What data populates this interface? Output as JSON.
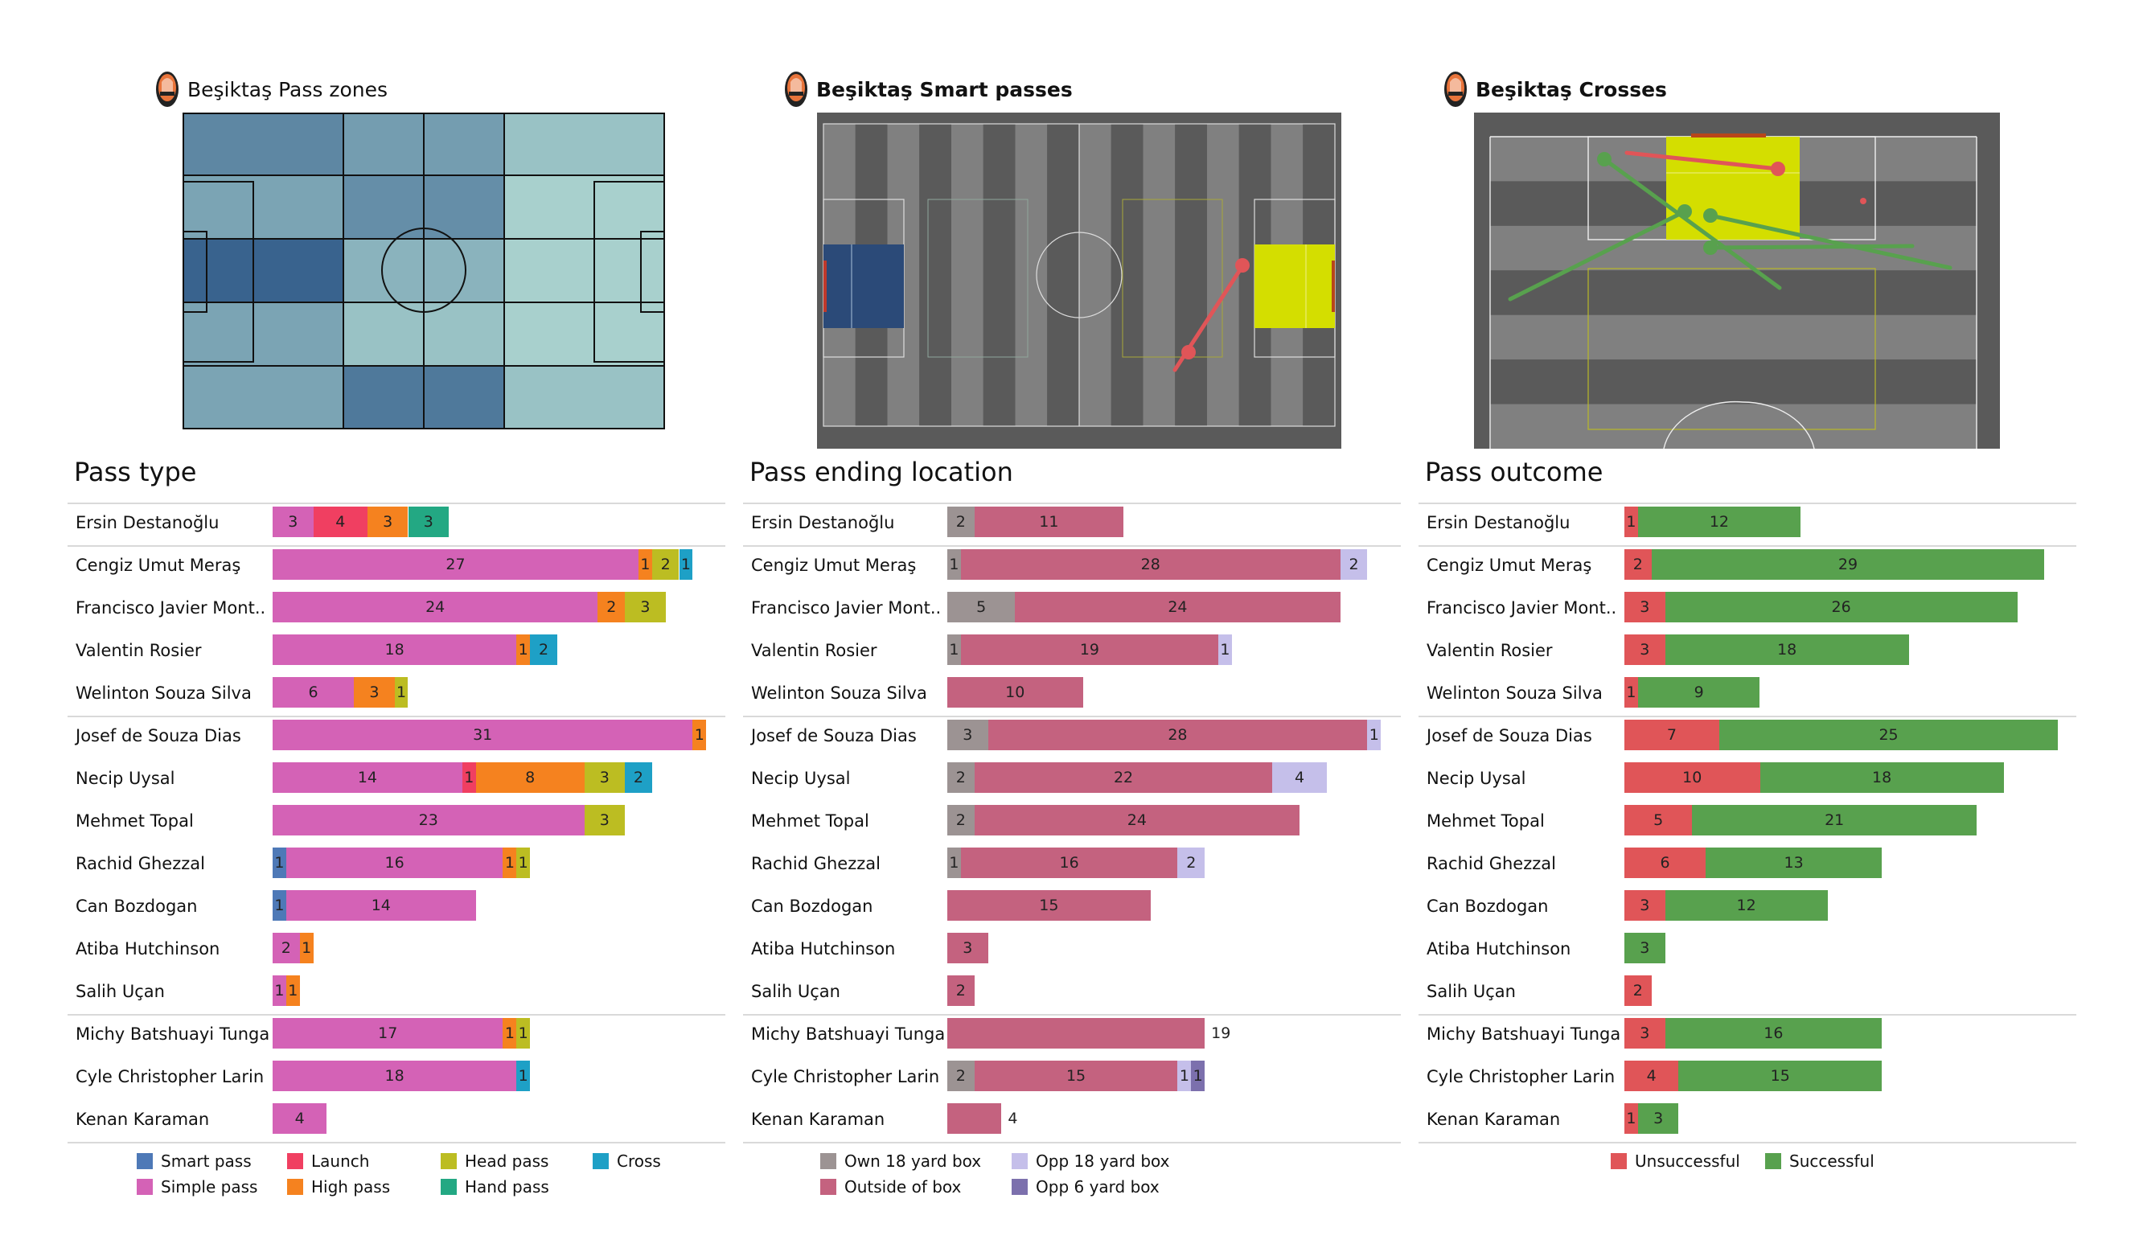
{
  "panels": {
    "pass_zones": {
      "title": "Beşiktaş Pass zones"
    },
    "smart_passes": {
      "title": "Beşiktaş Smart passes"
    },
    "crosses": {
      "title": "Beşiktaş Crosses"
    }
  },
  "colors": {
    "smart_pass": "#4e79b7",
    "simple_pass": "#d462b6",
    "launch": "#f03f61",
    "high_pass": "#f5821f",
    "head_pass": "#bcbd22",
    "hand_pass": "#23a883",
    "cross": "#1ea0c6",
    "own_18": "#9c9393",
    "outside_box": "#c4627f",
    "opp_18": "#c5bfea",
    "opp_6": "#7c70ad",
    "unsuccessful": "#e05558",
    "successful": "#58a14e"
  },
  "chart_data": [
    {
      "type": "heatmap",
      "title": "Beşiktaş Pass zones",
      "grid": {
        "columns": [
          "0-33",
          "33-50",
          "50-67",
          "67-100"
        ],
        "rows": [
          "top",
          "upper-mid",
          "centre",
          "lower-mid",
          "bottom"
        ],
        "intensity": [
          [
            0.65,
            0.5,
            0.5,
            0.25
          ],
          [
            0.45,
            0.6,
            0.6,
            0.15
          ],
          [
            0.9,
            0.35,
            0.35,
            0.15
          ],
          [
            0.45,
            0.25,
            0.25,
            0.15
          ],
          [
            0.45,
            0.75,
            0.75,
            0.25
          ]
        ],
        "note": "relative pass density, darker = more passes"
      }
    },
    {
      "type": "scatter",
      "title": "Beşiktaş Smart passes",
      "passes": [
        {
          "start": [
            75,
            24
          ],
          "end": [
            81,
            43
          ],
          "outcome": "unsuccessful"
        }
      ],
      "highlight_zones": [
        {
          "zone": "own 6-yard/18 area",
          "color": "#2e4e7e"
        },
        {
          "zone": "opponent box",
          "color": "#d4de00"
        }
      ]
    },
    {
      "type": "scatter",
      "title": "Beşiktaş Crosses",
      "passes": [
        {
          "start": [
            97,
            38
          ],
          "end": [
            95,
            58
          ],
          "outcome": "unsuccessful"
        },
        {
          "start": [
            96,
            25
          ],
          "end": [
            91,
            44
          ],
          "outcome": "successful"
        },
        {
          "start": [
            88,
            15
          ],
          "end": [
            97,
            28
          ],
          "outcome": "successful"
        },
        {
          "start": [
            92,
            70
          ],
          "end": [
            94,
            49
          ],
          "outcome": "successful"
        },
        {
          "start": [
            88,
            74
          ],
          "end": [
            91,
            53
          ],
          "outcome": "successful"
        },
        {
          "start": [
            88,
            67
          ],
          "end": [
            94,
            52
          ],
          "outcome": "successful"
        },
        {
          "start": [
            93,
            84
          ],
          "end": [
            93,
            84
          ],
          "outcome": "unsuccessful"
        }
      ]
    },
    {
      "type": "bar",
      "title": "Pass type",
      "stacked": true,
      "orientation": "horizontal",
      "categories": [
        "Ersin Destanoğlu",
        "Cengiz Umut Meraş",
        "Francisco Javier Mont..",
        "Valentin Rosier",
        "Welinton Souza Silva",
        "Josef de Souza Dias",
        "Necip Uysal",
        "Mehmet Topal",
        "Rachid Ghezzal",
        "Can Bozdogan",
        "Atiba Hutchinson",
        "Salih Uçan",
        "Michy Batshuayi Tunga",
        "Cyle Christopher Larin",
        "Kenan Karaman"
      ],
      "series": [
        {
          "name": "Smart pass",
          "key": "smart_pass",
          "values": [
            0,
            0,
            0,
            0,
            0,
            0,
            0,
            0,
            1,
            1,
            0,
            0,
            0,
            0,
            0
          ]
        },
        {
          "name": "Simple pass",
          "key": "simple_pass",
          "values": [
            3,
            27,
            24,
            18,
            6,
            31,
            14,
            23,
            16,
            14,
            2,
            1,
            17,
            18,
            4
          ]
        },
        {
          "name": "Launch",
          "key": "launch",
          "values": [
            4,
            0,
            0,
            0,
            0,
            0,
            1,
            0,
            0,
            0,
            0,
            0,
            0,
            0,
            0
          ]
        },
        {
          "name": "High pass",
          "key": "high_pass",
          "values": [
            3,
            1,
            2,
            1,
            3,
            1,
            8,
            0,
            1,
            0,
            1,
            1,
            1,
            0,
            0
          ]
        },
        {
          "name": "Head pass",
          "key": "head_pass",
          "values": [
            0,
            2,
            3,
            0,
            1,
            0,
            3,
            3,
            1,
            0,
            0,
            0,
            1,
            0,
            0
          ]
        },
        {
          "name": "Hand pass",
          "key": "hand_pass",
          "values": [
            3,
            0,
            0,
            0,
            0,
            0,
            0,
            0,
            0,
            0,
            0,
            0,
            0,
            0,
            0
          ]
        },
        {
          "name": "Cross",
          "key": "cross",
          "values": [
            0,
            1,
            0,
            2,
            0,
            0,
            2,
            0,
            0,
            0,
            0,
            0,
            0,
            1,
            0
          ]
        }
      ],
      "legend": [
        {
          "label": "Smart pass",
          "key": "smart_pass"
        },
        {
          "label": "Launch",
          "key": "launch"
        },
        {
          "label": "Head pass",
          "key": "head_pass"
        },
        {
          "label": "Cross",
          "key": "cross"
        },
        {
          "label": "Simple pass",
          "key": "simple_pass"
        },
        {
          "label": "High pass",
          "key": "high_pass"
        },
        {
          "label": "Hand pass",
          "key": "hand_pass"
        }
      ],
      "groups_after_rows": [
        0,
        4,
        11
      ]
    },
    {
      "type": "bar",
      "title": "Pass ending location",
      "stacked": true,
      "orientation": "horizontal",
      "categories": [
        "Ersin Destanoğlu",
        "Cengiz Umut Meraş",
        "Francisco Javier Mont..",
        "Valentin Rosier",
        "Welinton Souza Silva",
        "Josef de Souza Dias",
        "Necip Uysal",
        "Mehmet Topal",
        "Rachid Ghezzal",
        "Can Bozdogan",
        "Atiba Hutchinson",
        "Salih Uçan",
        "Michy Batshuayi Tunga",
        "Cyle Christopher Larin",
        "Kenan Karaman"
      ],
      "series": [
        {
          "name": "Own 18 yard box",
          "key": "own_18",
          "values": [
            2,
            1,
            5,
            1,
            0,
            3,
            2,
            2,
            1,
            0,
            0,
            0,
            0,
            2,
            0
          ]
        },
        {
          "name": "Outside of box",
          "key": "outside_box",
          "values": [
            11,
            28,
            24,
            19,
            10,
            28,
            22,
            24,
            16,
            15,
            3,
            2,
            19,
            15,
            4
          ]
        },
        {
          "name": "Opp 18 yard box",
          "key": "opp_18",
          "values": [
            0,
            2,
            0,
            1,
            0,
            1,
            4,
            0,
            2,
            0,
            0,
            0,
            0,
            1,
            0
          ]
        },
        {
          "name": "Opp 6 yard box",
          "key": "opp_6",
          "values": [
            0,
            0,
            0,
            0,
            0,
            0,
            0,
            0,
            0,
            0,
            0,
            0,
            0,
            1,
            0
          ]
        }
      ],
      "outside_labels": [
        null,
        null,
        null,
        null,
        null,
        null,
        null,
        null,
        null,
        null,
        null,
        null,
        "19",
        null,
        "4"
      ],
      "legend": [
        {
          "label": "Own 18 yard box",
          "key": "own_18"
        },
        {
          "label": "Opp 18 yard box",
          "key": "opp_18"
        },
        {
          "label": "Outside of box",
          "key": "outside_box"
        },
        {
          "label": "Opp 6 yard box",
          "key": "opp_6"
        }
      ],
      "groups_after_rows": [
        0,
        4,
        11
      ]
    },
    {
      "type": "bar",
      "title": "Pass outcome",
      "stacked": true,
      "orientation": "horizontal",
      "categories": [
        "Ersin Destanoğlu",
        "Cengiz Umut Meraş",
        "Francisco Javier Mont..",
        "Valentin Rosier",
        "Welinton Souza Silva",
        "Josef de Souza Dias",
        "Necip Uysal",
        "Mehmet Topal",
        "Rachid Ghezzal",
        "Can Bozdogan",
        "Atiba Hutchinson",
        "Salih Uçan",
        "Michy Batshuayi Tunga",
        "Cyle Christopher Larin",
        "Kenan Karaman"
      ],
      "series": [
        {
          "name": "Unsuccessful",
          "key": "unsuccessful",
          "values": [
            1,
            2,
            3,
            3,
            1,
            7,
            10,
            5,
            6,
            3,
            0,
            2,
            3,
            4,
            1
          ]
        },
        {
          "name": "Successful",
          "key": "successful",
          "values": [
            12,
            29,
            26,
            18,
            9,
            25,
            18,
            21,
            13,
            12,
            3,
            0,
            16,
            15,
            3
          ]
        }
      ],
      "legend": [
        {
          "label": "Unsuccessful",
          "key": "unsuccessful"
        },
        {
          "label": "Successful",
          "key": "successful"
        }
      ],
      "groups_after_rows": [
        0,
        4,
        11
      ]
    }
  ]
}
